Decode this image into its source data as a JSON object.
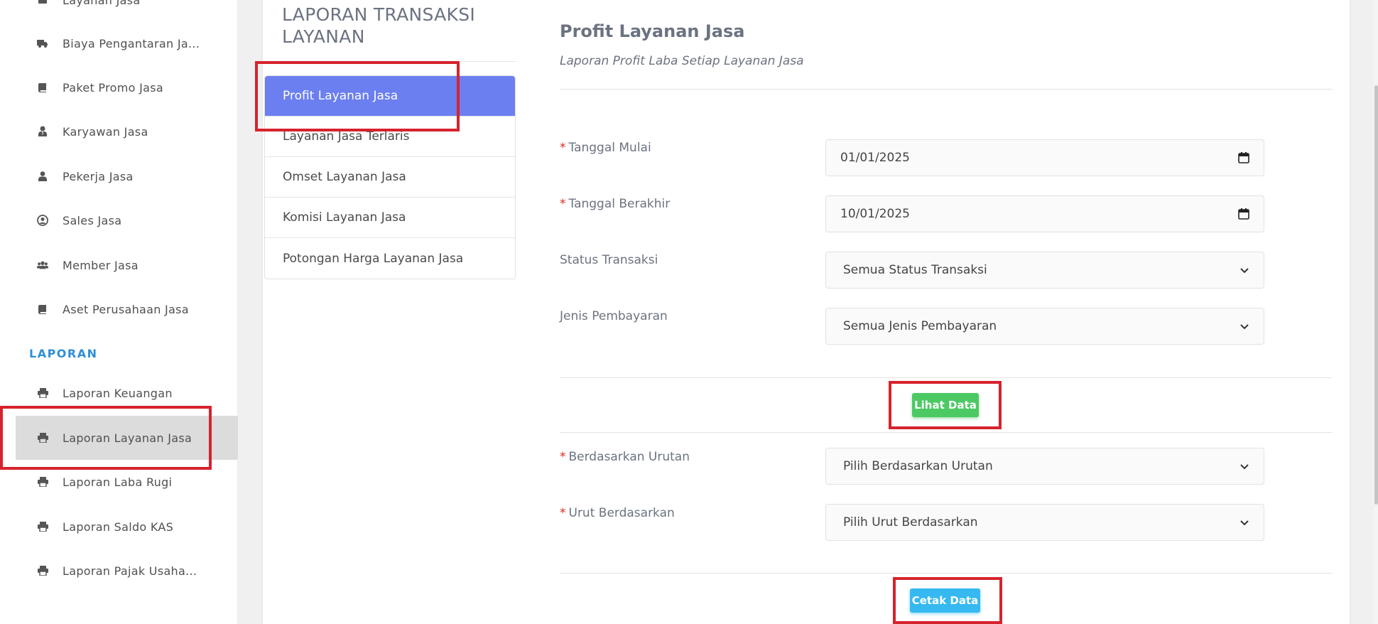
{
  "sidebar": {
    "items": [
      {
        "label": "Layanan Jasa",
        "icon": "box-icon"
      },
      {
        "label": "Biaya Pengantaran Ja...",
        "icon": "truck-icon"
      },
      {
        "label": "Paket Promo Jasa",
        "icon": "book-icon"
      },
      {
        "label": "Karyawan Jasa",
        "icon": "user-tie-icon"
      },
      {
        "label": "Pekerja Jasa",
        "icon": "user-icon"
      },
      {
        "label": "Sales Jasa",
        "icon": "user-circle-icon"
      },
      {
        "label": "Member Jasa",
        "icon": "users-icon"
      },
      {
        "label": "Aset Perusahaan Jasa",
        "icon": "book-icon"
      }
    ],
    "section_heading": "LAPORAN",
    "report_items": [
      {
        "label": "Laporan Keuangan",
        "icon": "print-icon"
      },
      {
        "label": "Laporan Layanan Jasa",
        "icon": "print-icon",
        "active": true
      },
      {
        "label": "Laporan Laba Rugi",
        "icon": "print-icon"
      },
      {
        "label": "Laporan Saldo KAS",
        "icon": "print-icon"
      },
      {
        "label": "Laporan Pajak Usaha...",
        "icon": "print-icon"
      }
    ]
  },
  "report_menu": {
    "title": "LAPORAN TRANSAKSI LAYANAN",
    "items": [
      {
        "label": "Profit Layanan Jasa",
        "active": true
      },
      {
        "label": "Layanan Jasa Terlaris"
      },
      {
        "label": "Omset Layanan Jasa"
      },
      {
        "label": "Komisi Layanan Jasa"
      },
      {
        "label": "Potongan Harga Layanan Jasa"
      }
    ]
  },
  "main": {
    "title": "Profit Layanan Jasa",
    "subtitle": "Laporan Profit Laba Setiap Layanan Jasa",
    "required_mark": "*",
    "fields": {
      "start_date": {
        "label": "Tanggal Mulai",
        "value": "01/01/2025"
      },
      "end_date": {
        "label": "Tanggal Berakhir",
        "value": "10/01/2025"
      },
      "status": {
        "label": "Status Transaksi",
        "value": "Semua Status Transaksi"
      },
      "payment": {
        "label": "Jenis Pembayaran",
        "value": "Semua Jenis Pembayaran"
      },
      "order_by": {
        "label": "Berdasarkan Urutan",
        "value": "Pilih Berdasarkan Urutan"
      },
      "sort_by": {
        "label": "Urut Berdasarkan",
        "value": "Pilih Urut Berdasarkan"
      }
    },
    "view_button": "Lihat Data",
    "print_button": "Cetak Data"
  },
  "colors": {
    "accent": "#6b7ff0",
    "highlight": "#d6232d",
    "green": "#4cc963",
    "blue": "#35b9f0",
    "section": "#2e8fd8"
  }
}
